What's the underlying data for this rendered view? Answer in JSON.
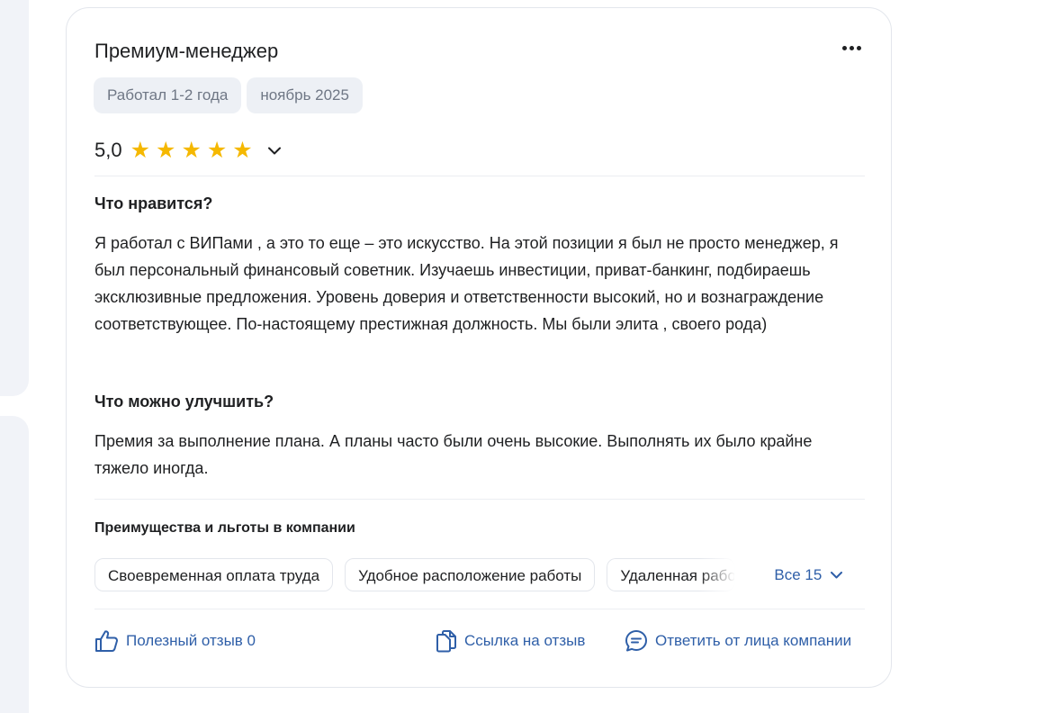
{
  "review": {
    "position_title": "Премиум-менеджер",
    "tags": [
      "Работал 1-2 года",
      "ноябрь 2025"
    ],
    "rating_value": "5,0",
    "stars": 5,
    "likes_heading": "Что нравится?",
    "likes_text": "Я работал с ВИПами , а это то еще – это искусство. На этой позиции я был не просто менеджер, я был персональный финансовый советник. Изучаешь инвестиции, приват-банкинг, подбираешь эксклюзивные предложения. Уровень доверия и ответственности высокий, но и вознаграждение соответствующее. По-настоящему престижная должность. Мы были элита , своего рода)",
    "improve_heading": "Что можно улучшить?",
    "improve_text": "Премия за выполнение плана. А планы часто были очень высокие. Выполнять их было крайне тяжело иногда.",
    "benefits_heading": "Преимущества и льготы в компании",
    "benefits": [
      "Своевременная оплата труда",
      "Удобное расположение работы",
      "Удаленная работа"
    ],
    "benefits_all_label": "Все 15",
    "actions": {
      "helpful_label": "Полезный отзыв 0",
      "link_label": "Ссылка на отзыв",
      "reply_label": "Ответить от лица компании"
    }
  },
  "colors": {
    "accent": "#2f5fa8",
    "star": "#f5b800",
    "chip_bg": "#edf0f5",
    "border": "#e3e6ec"
  },
  "icons": {
    "menu": "more-dots-icon",
    "rating_toggle": "chevron-down-icon",
    "all_toggle": "chevron-down-icon",
    "helpful": "thumbs-up-icon",
    "link": "copy-link-icon",
    "reply": "chat-bubble-icon"
  }
}
